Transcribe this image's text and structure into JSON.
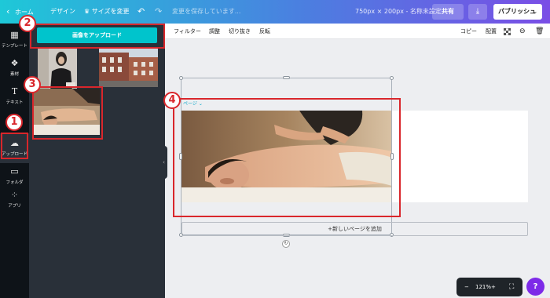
{
  "topbar": {
    "home": "ホーム",
    "design": "デザイン",
    "resize": "サイズを変更",
    "undo_icon": "undo-icon",
    "redo_icon": "redo-icon",
    "save_status": "変更を保存しています...",
    "doc_size": "750px × 200px - 名称未設定",
    "share": "共有",
    "download_icon": "download-icon",
    "publish": "パブリッシュ"
  },
  "rail": {
    "items": [
      {
        "label": "テンプレート",
        "icon": "template-icon"
      },
      {
        "label": "素材",
        "icon": "elements-icon"
      },
      {
        "label": "テキスト",
        "icon": "text-icon"
      },
      {
        "label": "アップロード",
        "icon": "upload-icon"
      },
      {
        "label": "フォルダ",
        "icon": "folder-icon"
      },
      {
        "label": "アプリ",
        "icon": "apps-icon"
      }
    ]
  },
  "panel": {
    "upload_button": "画像をアップロード"
  },
  "toolbar": {
    "filter": "フィルター",
    "adjust": "調整",
    "crop": "切り抜き",
    "flip": "反転",
    "copy": "コピー",
    "arrange": "配置"
  },
  "canvas": {
    "page_label": "ページ",
    "add_page": "+新しいページを追加"
  },
  "zoom": {
    "minus": "−",
    "level": "121%",
    "plus": "+"
  },
  "help": "?",
  "annotations": [
    "1",
    "2",
    "3",
    "4"
  ],
  "colors": {
    "accent": "#00c4cc",
    "annotation_red": "#d9262b",
    "help_purple": "#7d2ae8"
  }
}
